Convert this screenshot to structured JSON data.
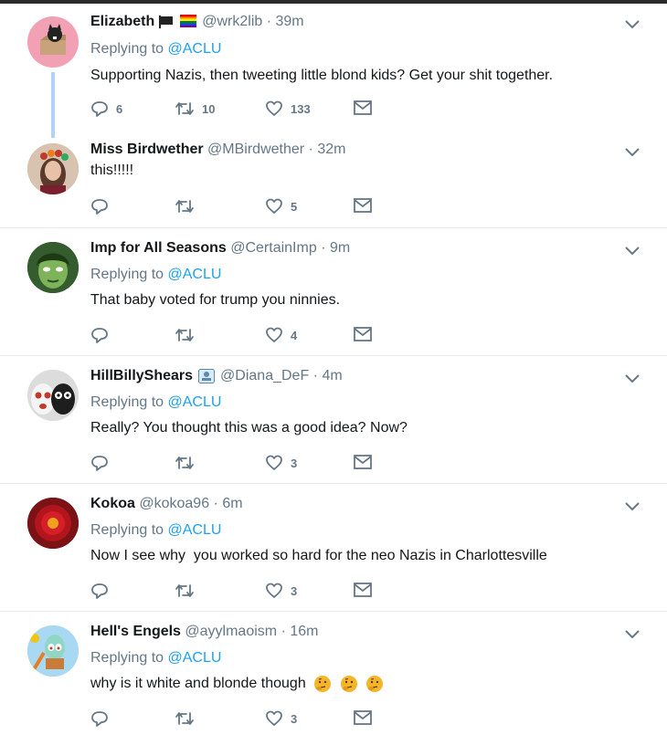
{
  "tweets": [
    {
      "name": "Elizabeth",
      "handle": "@wrk2lib",
      "time": "· 39m",
      "replying_prefix": "Replying to",
      "replying_to": "@ACLU",
      "text": "Supporting Nazis, then tweeting little blond kids? Get your shit together.",
      "replies": "6",
      "retweets": "10",
      "likes": "133",
      "avatar": "cat-box-avatar",
      "name_icons": [
        "black-flag-icon",
        "rainbow-flag-icon"
      ]
    },
    {
      "name": "Miss Birdwether",
      "handle": "@MBirdwether",
      "time": "· 32m",
      "text": "this!!!!!",
      "replies": "",
      "retweets": "",
      "likes": "5",
      "avatar": "woman-flower-crown-avatar"
    },
    {
      "name": "Imp for All Seasons",
      "handle": "@CertainImp",
      "time": "· 9m",
      "replying_prefix": "Replying to",
      "replying_to": "@ACLU",
      "text": "That baby voted for trump you ninnies.",
      "replies": "",
      "retweets": "",
      "likes": "4",
      "avatar": "green-face-avatar"
    },
    {
      "name": "HillBillyShears",
      "handle": "@Diana_DeF",
      "time": "· 4m",
      "replying_prefix": "Replying to",
      "replying_to": "@ACLU",
      "text": "Really? You thought this was a good idea? Now?",
      "replies": "",
      "retweets": "",
      "likes": "3",
      "avatar": "masks-avatar",
      "name_icons": [
        "picture-badge-icon"
      ]
    },
    {
      "name": "Kokoa",
      "handle": "@kokoa96",
      "time": "· 6m",
      "replying_prefix": "Replying to",
      "replying_to": "@ACLU",
      "text": "Now I see why  you worked so hard for the neo Nazis in Charlottesville",
      "replies": "",
      "retweets": "",
      "likes": "3",
      "avatar": "red-flower-avatar"
    },
    {
      "name": "Hell's Engels",
      "handle": "@ayylmaoism",
      "time": "· 16m",
      "replying_prefix": "Replying to",
      "replying_to": "@ACLU",
      "text": "why is it white and blonde though",
      "replies": "",
      "retweets": "",
      "likes": "3",
      "avatar": "cartoon-squid-avatar",
      "trailing_icons": [
        "thinking-face-emoji",
        "thinking-face-emoji",
        "thinking-face-emoji"
      ]
    }
  ],
  "colors": {
    "name": "#14171a",
    "secondary": "#657786",
    "link": "#1da1f2",
    "divider": "#e6ecf0",
    "thread_line": "#b3d4f5"
  }
}
